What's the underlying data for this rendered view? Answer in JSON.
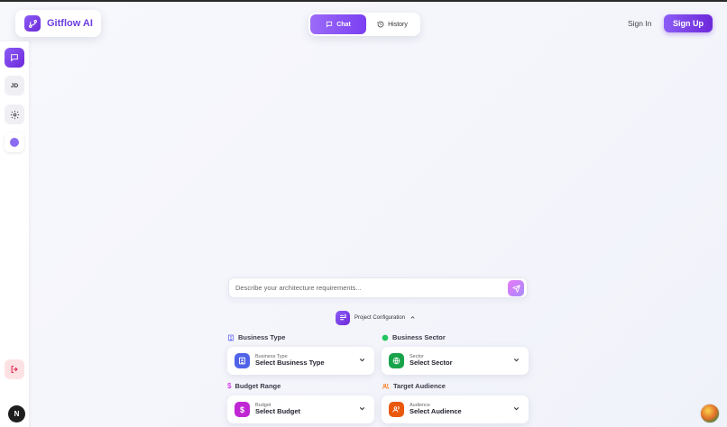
{
  "app": {
    "name": "Gitflow AI"
  },
  "tabs": [
    {
      "label": "Chat"
    },
    {
      "label": "History"
    }
  ],
  "auth": {
    "sign_in": "Sign In",
    "sign_up": "Sign Up"
  },
  "sidebar": {
    "user_initials": "JD"
  },
  "bottom_badge": "N",
  "prompt": {
    "placeholder": "Describe your architecture requirements..."
  },
  "config": {
    "label": "Project Configuration"
  },
  "fields": {
    "business_type": {
      "label": "Business Type",
      "small": "Business Type",
      "value": "Select Business Type"
    },
    "business_sector": {
      "label": "Business Sector",
      "small": "Sector",
      "value": "Select Sector"
    },
    "budget_range": {
      "label": "Budget Range",
      "small": "Budget",
      "value": "Select Budget"
    },
    "target_audience": {
      "label": "Target Audience",
      "small": "Audience",
      "value": "Select Audience"
    }
  },
  "colors": {
    "accent": "#7c3aed",
    "sector": "#22c55e",
    "budget": "#d946ef",
    "audience": "#f97316",
    "business": "#6366f1"
  }
}
